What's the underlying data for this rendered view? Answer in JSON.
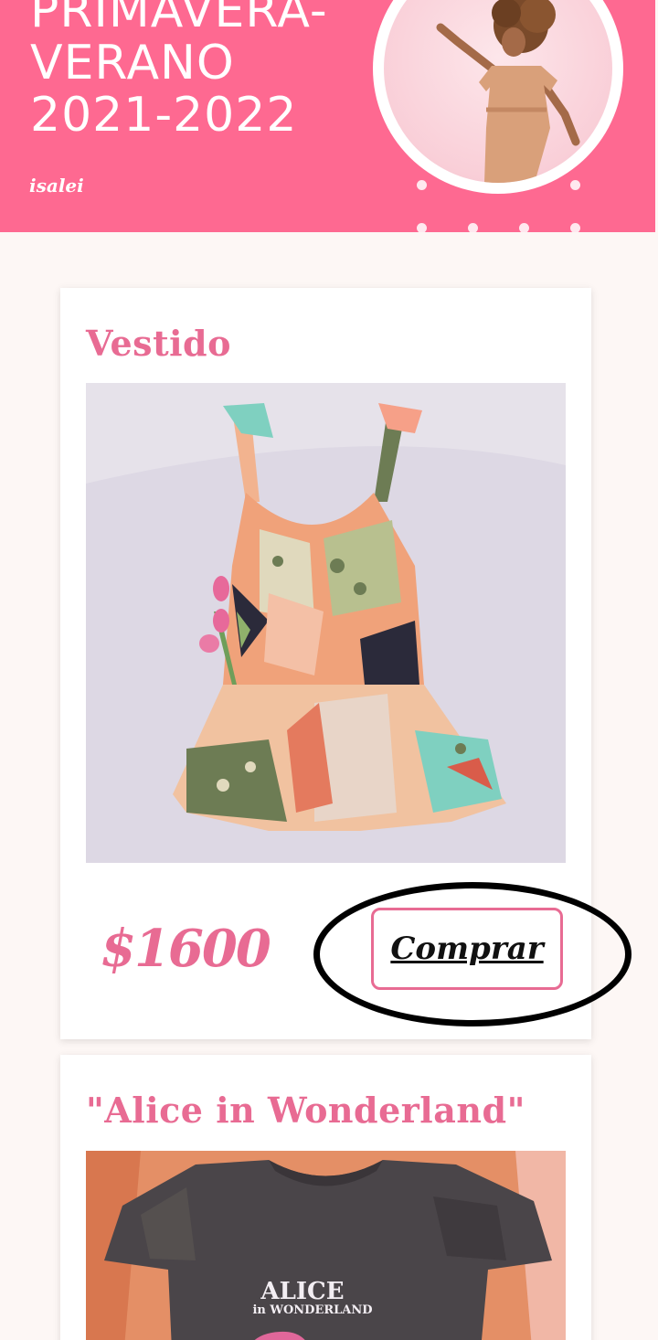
{
  "hero": {
    "title_lines": [
      "PRIMAVERA-",
      "VERANO",
      "2021-2022"
    ],
    "brand": "isalei",
    "background_color": "#fe6991"
  },
  "products": [
    {
      "title": "Vestido",
      "image_alt": "floral sleeveless dress laid flat with pink tulips",
      "price": "$1600",
      "buy_label": "Comprar"
    },
    {
      "title": "\"Alice in Wonderland\"",
      "image_alt": "grey acid-wash t-shirt with Alice in Wonderland print",
      "shirt_print_line1": "ALICE",
      "shirt_print_line2": "in WONDERLAND"
    }
  ],
  "colors": {
    "accent": "#e86b93",
    "page_bg": "#fdf7f5",
    "annotation": "#000000"
  }
}
